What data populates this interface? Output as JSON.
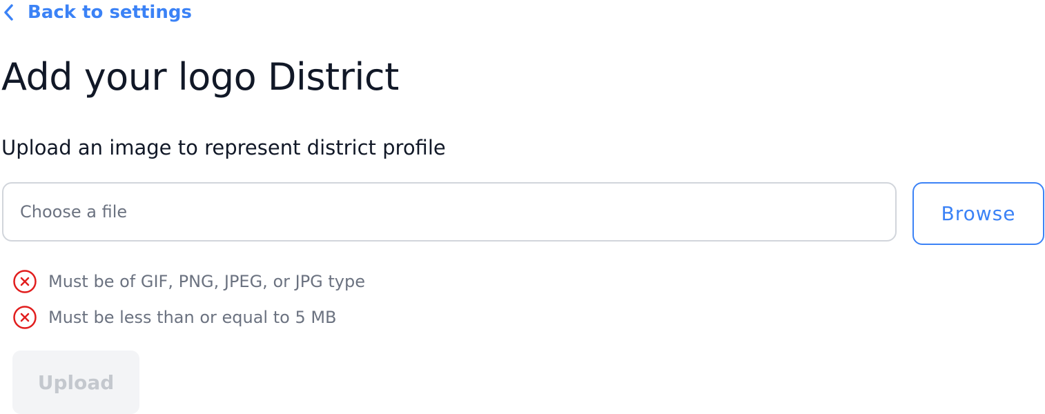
{
  "nav": {
    "back_label": "Back to settings",
    "back_icon": "chevron-left-icon"
  },
  "header": {
    "title": "Add your logo District",
    "subtitle": "Upload an image to represent district profile"
  },
  "file_picker": {
    "value": "",
    "placeholder": "Choose a file",
    "browse_label": "Browse"
  },
  "validation": {
    "icon": "error-circle-x-icon",
    "error_color": "#e11d1d",
    "rules": [
      {
        "text": "Must be of GIF, PNG, JPEG, or JPG type",
        "status": "failed"
      },
      {
        "text": "Must be less than or equal to 5 MB",
        "status": "failed"
      }
    ]
  },
  "actions": {
    "upload_label": "Upload",
    "upload_disabled": true
  },
  "colors": {
    "accent": "#3b82f6",
    "text": "#111827",
    "muted": "#6b7280",
    "disabled_bg": "#f3f4f6",
    "disabled_text": "#c4c8ce"
  }
}
